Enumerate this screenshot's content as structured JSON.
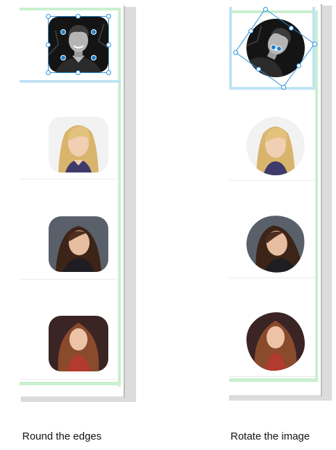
{
  "captions": {
    "left": "Round the edges",
    "right": "Rotate the image"
  },
  "colors": {
    "selection": "#2a8fd8",
    "guide_green": "#c9f0cf",
    "guide_blue": "#bfe3f5"
  },
  "icons": {
    "handle": "resize-handle-icon",
    "rotate": "rotation-handle-icon"
  }
}
